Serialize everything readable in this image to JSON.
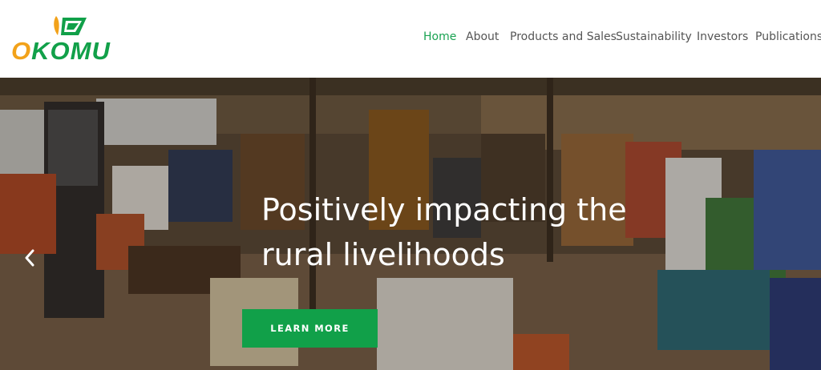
{
  "brand": {
    "name": "OKOMU",
    "first_letter": "O",
    "rest": "KOMU",
    "colors": {
      "green": "#11a049",
      "orange": "#f2a21a"
    }
  },
  "nav": {
    "items": [
      {
        "label": "Home",
        "active": true
      },
      {
        "label": "About",
        "active": false
      },
      {
        "label": "Products and Sales",
        "active": false
      },
      {
        "label": "Sustainability",
        "active": false
      },
      {
        "label": "Investors",
        "active": false
      },
      {
        "label": "Publications",
        "active": false
      }
    ]
  },
  "hero": {
    "title_line1": "Positively impacting the",
    "title_line2": "rural livelihoods",
    "cta_label": "LEARN MORE",
    "prev_icon": "chevron-left-icon"
  }
}
